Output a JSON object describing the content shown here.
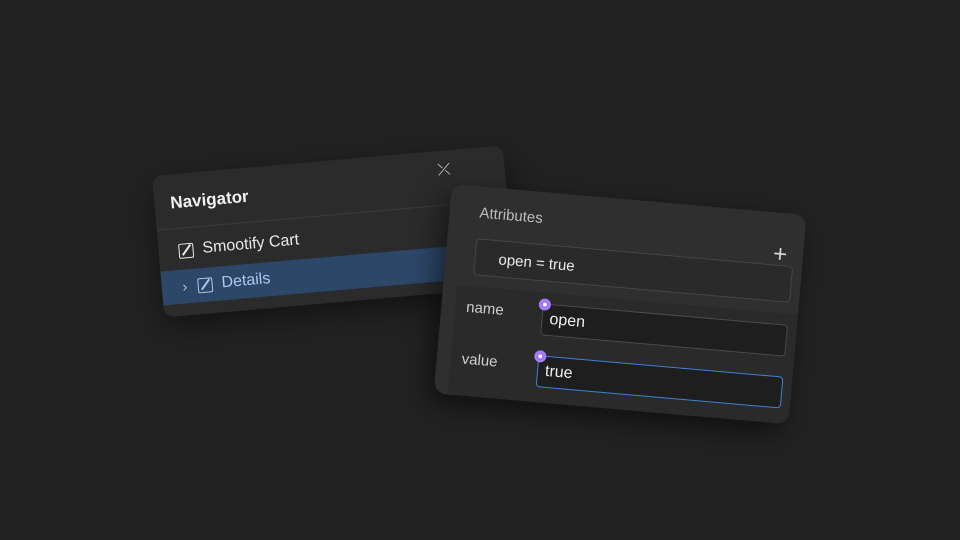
{
  "navigator": {
    "title": "Navigator",
    "close_icon": "chevrons-collapse-icon",
    "items": [
      {
        "label": "Smootify Cart",
        "icon": "element-icon",
        "selected": false
      },
      {
        "label": "Details",
        "icon": "element-icon",
        "expand_icon": "chevron-right-icon",
        "selected": true
      }
    ]
  },
  "attributes": {
    "title": "Attributes",
    "add_icon": "plus-icon",
    "summary": "open = true",
    "name_label": "name",
    "name_value": "open",
    "value_label": "value",
    "value_value": "true"
  },
  "colors": {
    "background": "#222222",
    "panel": "#2b2b2b",
    "selected_row": "#2d4769",
    "focus_border": "#3b82d6",
    "cursor_dot": "#8f5cf2"
  }
}
